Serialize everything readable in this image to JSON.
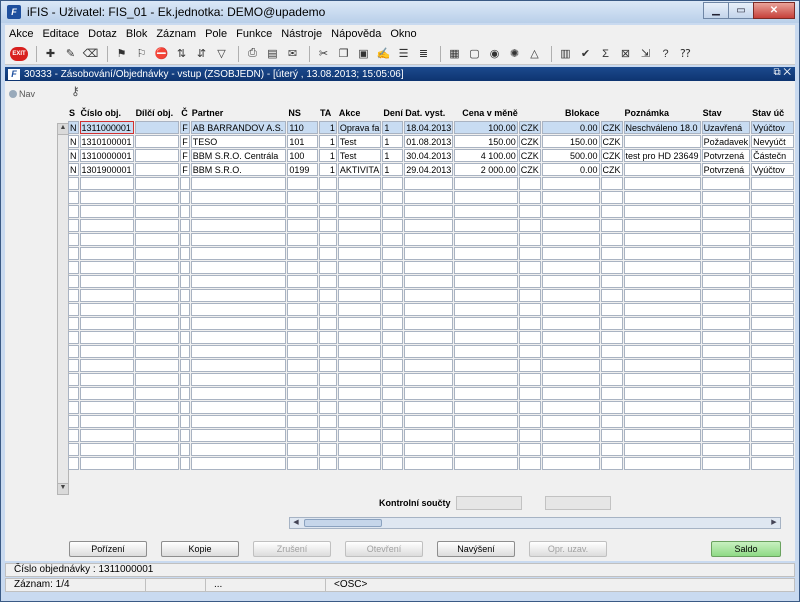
{
  "window": {
    "title": "iFIS - Uživatel: FIS_01 - Ek.jednotka: DEMO@upademo",
    "icon_letter": "F"
  },
  "menu": [
    "Akce",
    "Editace",
    "Dotaz",
    "Blok",
    "Záznam",
    "Pole",
    "Funkce",
    "Nástroje",
    "Nápověda",
    "Okno"
  ],
  "toolbar": {
    "exit_label": "EXIT"
  },
  "form": {
    "title": "30333 - Zásobování/Objednávky - vstup (ZSOBJEDN) - [úterý , 13.08.2013; 15:05:06]",
    "nav_label": "Nav"
  },
  "table": {
    "columns": [
      "S",
      "Číslo obj.",
      "Dílčí obj.",
      "Č",
      "Partner",
      "NS",
      "TA",
      "Akce",
      "Dení",
      "Dat. vyst.",
      "Cena v měně",
      "",
      "Blokace",
      "",
      "Poznámka",
      "Stav",
      "Stav úč"
    ],
    "rows": [
      [
        "N",
        "1311000001",
        "",
        "F",
        "AB BARRANDOV A.S.",
        "110",
        "1",
        "Oprava fa",
        "1",
        "18.04.2013",
        "100.00",
        "CZK",
        "0.00",
        "CZK",
        "Neschváleno 18.0",
        "Uzavřená",
        "Vyúčtov"
      ],
      [
        "N",
        "1310100001",
        "",
        "F",
        "TESO",
        "101",
        "1",
        "Test",
        "1",
        "01.08.2013",
        "150.00",
        "CZK",
        "150.00",
        "CZK",
        "",
        "Požadavek",
        "Nevyúčt"
      ],
      [
        "N",
        "1310000001",
        "",
        "F",
        "BBM S.R.O. Centrála",
        "100",
        "1",
        "Test",
        "1",
        "30.04.2013",
        "4 100.00",
        "CZK",
        "500.00",
        "CZK",
        "test pro HD 23649",
        "Potvrzená",
        "Částečn"
      ],
      [
        "N",
        "1301900001",
        "",
        "F",
        "BBM S.R.O.",
        "0199",
        "1",
        "AKTIVITA",
        "1",
        "29.04.2013",
        "2 000.00",
        "CZK",
        "0.00",
        "CZK",
        "",
        "Potvrzená",
        "Vyúčtov"
      ]
    ],
    "empty_rows": 21
  },
  "totals": {
    "label": "Kontrolní součty"
  },
  "buttons": {
    "porizeni": "Pořízení",
    "kopie": "Kopie",
    "zruseni": "Zrušení",
    "otevreni": "Otevření",
    "navyseni": "Navýšení",
    "opr_uzav": "Opr. uzav.",
    "saldo": "Saldo"
  },
  "status": {
    "field_info": "Číslo objednávky : 1311000001",
    "record": "Záznam: 1/4",
    "cell3": "...",
    "mode": "<OSC>"
  }
}
